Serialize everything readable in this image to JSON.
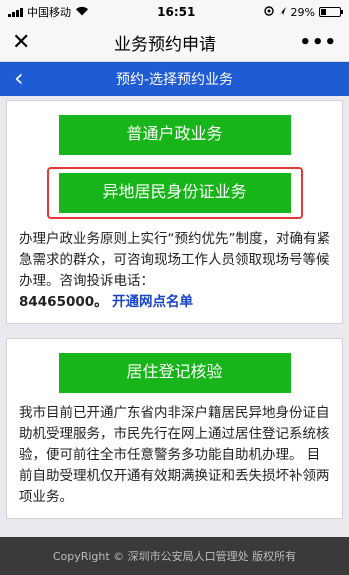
{
  "status_bar": {
    "carrier": "中国移动",
    "time": "16:51",
    "battery": "29%",
    "battery_level": 0.29
  },
  "navbar": {
    "title": "业务预约申请",
    "more_label": "•••"
  },
  "subheader": {
    "title": "预约-选择预约业务"
  },
  "card1": {
    "button1_label": "普通户政业务",
    "button2_label": "异地居民身份证业务",
    "description": "办理户政业务原则上实行“预约优先”制度，对确有紧急需求的群众，可咨询现场工作人员领取现场号等候办理。咨询投诉电话：",
    "phone": "84465000。",
    "link_label": "开通网点名单"
  },
  "card2": {
    "button_label": "居住登记核验",
    "description": "我市目前已开通广东省内非深户籍居民异地身份证自助机受理服务，市民先行在网上通过居住登记系统核验，便可前往全市任意警务多功能自助机办理。 目前自助受理机仅开通有效期满换证和丢失损坏补领两项业务。"
  },
  "footer": {
    "copyright": "CopyRight © 深圳市公安局人口管理处 版权所有"
  },
  "colors": {
    "accent_blue": "#1f5bd3",
    "button_green": "#17b51a",
    "highlight_red": "#e53935"
  }
}
